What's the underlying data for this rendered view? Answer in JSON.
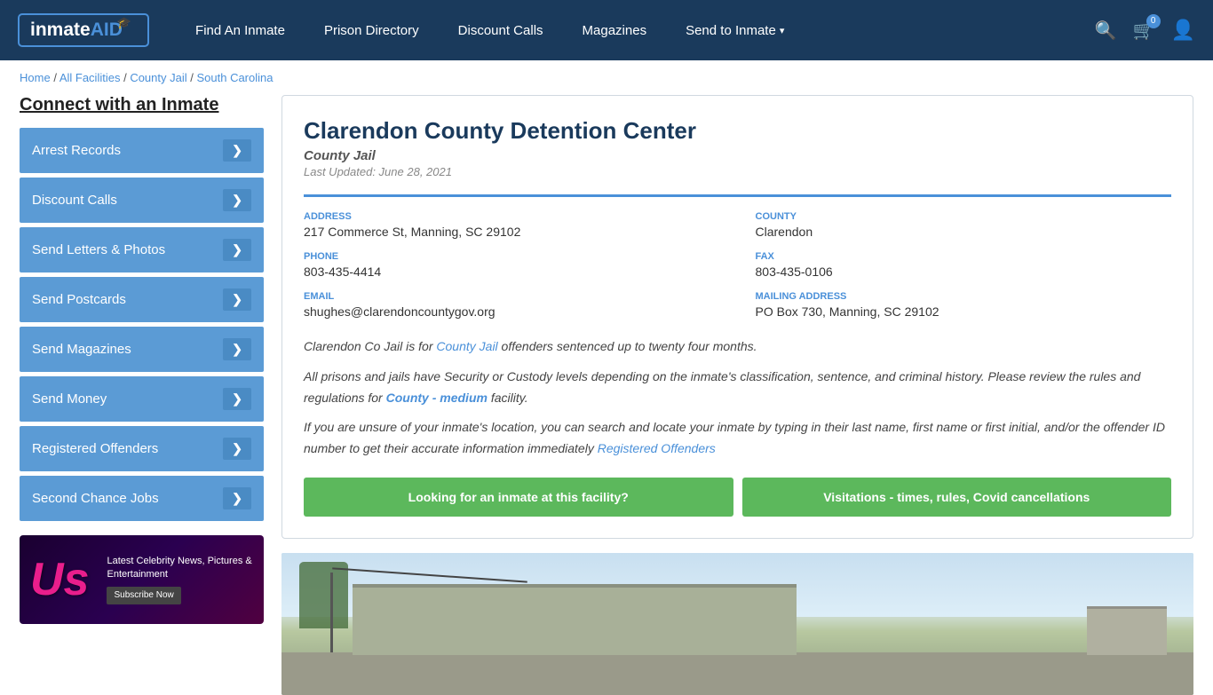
{
  "nav": {
    "logo_main": "inmate",
    "logo_aid": "AID",
    "links": [
      {
        "id": "find-inmate",
        "label": "Find An Inmate",
        "has_dropdown": false
      },
      {
        "id": "prison-directory",
        "label": "Prison Directory",
        "has_dropdown": false
      },
      {
        "id": "discount-calls",
        "label": "Discount Calls",
        "has_dropdown": false
      },
      {
        "id": "magazines",
        "label": "Magazines",
        "has_dropdown": false
      },
      {
        "id": "send-to-inmate",
        "label": "Send to Inmate",
        "has_dropdown": true
      }
    ],
    "cart_count": "0",
    "search_label": "Search"
  },
  "breadcrumb": {
    "home": "Home",
    "all_facilities": "All Facilities",
    "county_jail": "County Jail",
    "state": "South Carolina",
    "sep": " / "
  },
  "sidebar": {
    "title": "Connect with an Inmate",
    "items": [
      {
        "id": "arrest-records",
        "label": "Arrest Records"
      },
      {
        "id": "discount-calls",
        "label": "Discount Calls"
      },
      {
        "id": "send-letters-photos",
        "label": "Send Letters & Photos"
      },
      {
        "id": "send-postcards",
        "label": "Send Postcards"
      },
      {
        "id": "send-magazines",
        "label": "Send Magazines"
      },
      {
        "id": "send-money",
        "label": "Send Money"
      },
      {
        "id": "registered-offenders",
        "label": "Registered Offenders"
      },
      {
        "id": "second-chance-jobs",
        "label": "Second Chance Jobs"
      }
    ],
    "arrow": "❯",
    "ad": {
      "us_logo": "Us",
      "headline": "Latest Celebrity News, Pictures & Entertainment",
      "cta": "Subscribe Now"
    }
  },
  "facility": {
    "name": "Clarendon County Detention Center",
    "type": "County Jail",
    "last_updated": "Last Updated: June 28, 2021",
    "address_label": "ADDRESS",
    "address": "217 Commerce St, Manning, SC 29102",
    "county_label": "COUNTY",
    "county": "Clarendon",
    "phone_label": "PHONE",
    "phone": "803-435-4414",
    "fax_label": "FAX",
    "fax": "803-435-0106",
    "email_label": "EMAIL",
    "email": "shughes@clarendoncountygov.org",
    "mailing_label": "MAILING ADDRESS",
    "mailing": "PO Box 730, Manning, SC 29102",
    "desc1": "Clarendon Co Jail is for County Jail offenders sentenced up to twenty four months.",
    "desc2": "All prisons and jails have Security or Custody levels depending on the inmate's classification, sentence, and criminal history. Please review the rules and regulations for County - medium facility.",
    "desc3": "If you are unsure of your inmate's location, you can search and locate your inmate by typing in their last name, first name or first initial, and/or the offender ID number to get their accurate information immediately Registered Offenders",
    "btn1": "Looking for an inmate at this facility?",
    "btn2": "Visitations - times, rules, Covid cancellations"
  }
}
